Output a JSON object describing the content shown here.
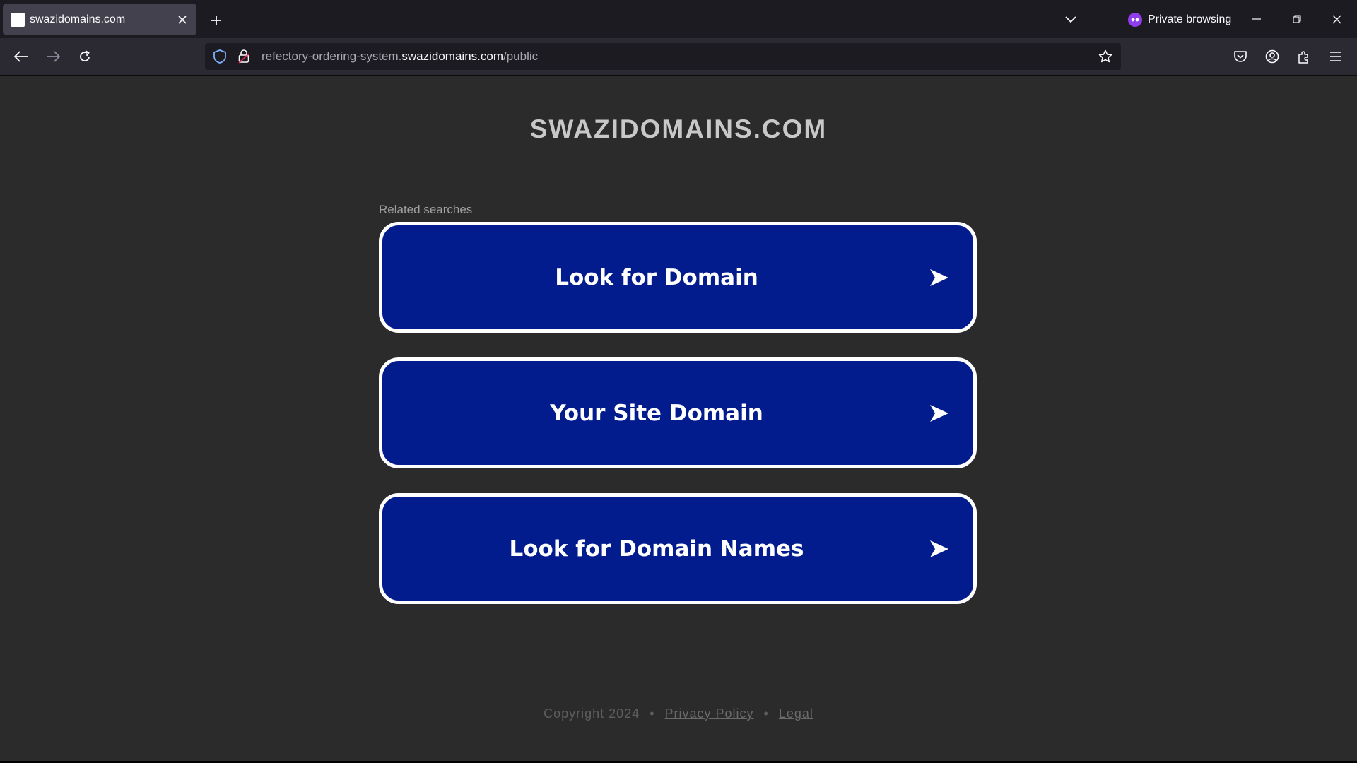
{
  "browser": {
    "tab": {
      "title": "swazidomains.com"
    },
    "private_label": "Private browsing",
    "url": {
      "prefix": "refectory-ordering-system.",
      "host": "swazidomains.com",
      "path": "/public"
    }
  },
  "page": {
    "site_title": "SWAZIDOMAINS.COM",
    "related_label": "Related searches",
    "searches": [
      {
        "label": "Look for Domain"
      },
      {
        "label": "Your Site Domain"
      },
      {
        "label": "Look for Domain Names"
      }
    ],
    "footer": {
      "copyright": "Copyright 2024",
      "separator": "•",
      "privacy": "Privacy Policy",
      "legal": "Legal"
    }
  },
  "colors": {
    "card_background": "#021b8d",
    "card_border": "#ffffff",
    "page_background": "#2b2b2b",
    "private_accent": "#8f3ded"
  },
  "icons": [
    "favicon",
    "close-icon",
    "plus-icon",
    "chevron-down-icon",
    "private-mask-icon",
    "minimize-icon",
    "restore-icon",
    "window-close-icon",
    "back-arrow-icon",
    "forward-arrow-icon",
    "reload-icon",
    "shield-icon",
    "lock-icon",
    "star-icon",
    "pocket-icon",
    "account-icon",
    "extensions-icon",
    "menu-icon",
    "arrow-right-icon"
  ]
}
